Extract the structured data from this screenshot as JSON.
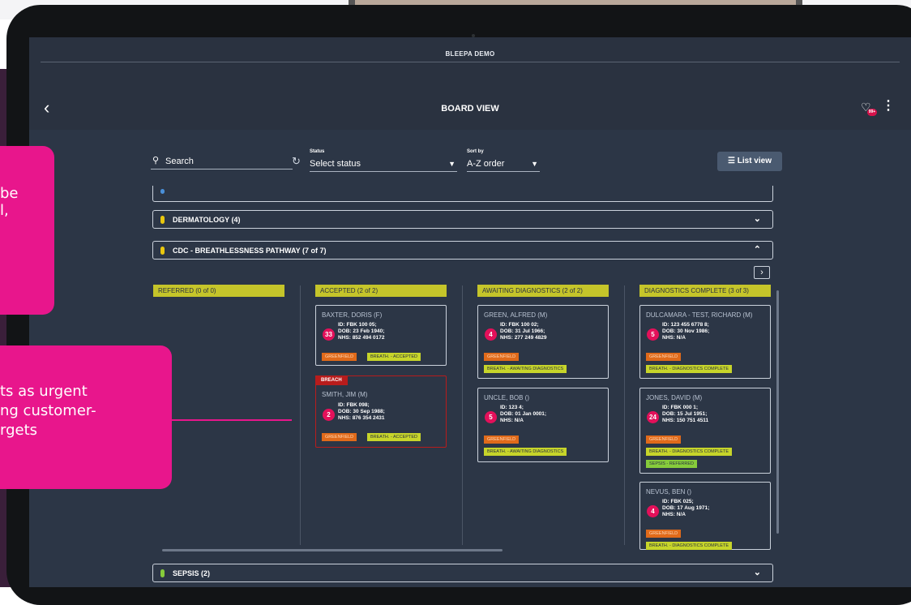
{
  "app": {
    "window_title": "BLEEPA DEMO",
    "screen_title": "BOARD VIEW",
    "notification_count": "99+"
  },
  "filters": {
    "search_label": "Search",
    "status_caption": "Status",
    "status_value": "Select status",
    "sort_caption": "Sort by",
    "sort_value": "A-Z order",
    "list_view_label": "List view"
  },
  "groups": {
    "clipped_label": "(?)",
    "dermatology": "DERMATOLOGY (4)",
    "cdc": "CDC - BREATHLESSNESS PATHWAY (7 of 7)",
    "sepsis": "SEPSIS (2)"
  },
  "columns": [
    "REFERRED (0 of 0)",
    "ACCEPTED (2 of 2)",
    "AWAITING DIAGNOSTICS (2 of 2)",
    "DIAGNOSTICS COMPLETE (3 of 3)"
  ],
  "cards": {
    "baxter": {
      "name": "BAXTER, DORIS (F)",
      "badge": "33",
      "id": "ID: FBK 100 05;",
      "dob": "DOB: 23 Feb 1940;",
      "nhs": "NHS: 852 494 0172",
      "tag1": "GREENFIELD",
      "tag2": "BREATH. - ACCEPTED"
    },
    "smith": {
      "breach": "BREACH",
      "name": "SMITH, JIM (M)",
      "badge": "2",
      "id": "ID: FBK 098;",
      "dob": "DOB: 30 Sep 1988;",
      "nhs": "NHS: 876 354 2431",
      "tag1": "GREENFIELD",
      "tag2": "BREATH. - ACCEPTED"
    },
    "green": {
      "name": "GREEN, ALFRED (M)",
      "badge": "4",
      "id": "ID: FBK 100 02;",
      "dob": "DOB: 31 Jul 1966;",
      "nhs": "NHS: 277 249 4829",
      "tag1": "GREENFIELD",
      "tag2": "BREATH. - AWAITING DIAGNOSTICS"
    },
    "uncle": {
      "name": "UNCLE, BOB ()",
      "badge": "5",
      "id": "ID: 123 4;",
      "dob": "DOB: 01 Jan 0001;",
      "nhs": "NHS: N/A",
      "tag1": "GREENFIELD",
      "tag2": "BREATH. - AWAITING DIAGNOSTICS"
    },
    "dulcamara": {
      "name": "DULCAMARA - TEST, RICHARD (M)",
      "badge": "5",
      "id": "ID: 123 455 6778 8;",
      "dob": "DOB: 30 Nov 1986;",
      "nhs": "NHS: N/A",
      "tag1": "GREENFIELD",
      "tag2": "BREATH. - DIAGNOSTICS COMPLETE"
    },
    "jones": {
      "name": "JONES, DAVID (M)",
      "badge": "24",
      "id": "ID: FBK 000 1;",
      "dob": "DOB: 15 Jul 1951;",
      "nhs": "NHS: 150 751 4511",
      "tag1": "GREENFIELD",
      "tag2": "BREATH. - DIAGNOSTICS COMPLETE",
      "tag3": "SEPSIS - REFERRED"
    },
    "nevus": {
      "name": "NEVUS, BEN ()",
      "badge": "4",
      "id": "ID: FBK 025;",
      "dob": "DOB: 17 Aug 1971;",
      "nhs": "NHS: N/A",
      "tag1": "GREENFIELD",
      "tag2": "BREATH. - DIAGNOSTICS COMPLETE"
    }
  },
  "callouts": {
    "top_line1": "be",
    "top_line2": "l,",
    "bottom_line1": "ts as urgent",
    "bottom_line2": "ng customer-",
    "bottom_line3": "rgets"
  },
  "colors": {
    "accent_pink": "#e8168c",
    "screen_bg": "#2c3646",
    "column_header": "#c5c52a",
    "breach": "#b81c1c"
  }
}
